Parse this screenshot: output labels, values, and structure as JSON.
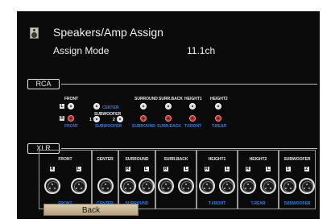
{
  "header": {
    "icon": "speaker-icon",
    "title": "Speakers/Amp Assign"
  },
  "assign_mode": {
    "label": "Assign Mode",
    "value": "11.1ch"
  },
  "rca": {
    "tag": "RCA",
    "front": {
      "label": "FRONT",
      "sub": "FRONT",
      "left_mark": "L",
      "right_mark": "R"
    },
    "center": {
      "label": "CENTER"
    },
    "subwoofer": {
      "label": "SUBWOOFER",
      "sub": "SUBWOOFER",
      "num1": "1",
      "num2": "2"
    },
    "surround": {
      "label": "SURROUND",
      "sub": "SURROUND"
    },
    "surr_back": {
      "label": "SURR.BACK",
      "sub": "SURR.BACK"
    },
    "height1": {
      "label": "HEIGHT1",
      "sub": "T.FRONT"
    },
    "height2": {
      "label": "HEIGHT2",
      "sub": "T.REAR"
    }
  },
  "xlr": {
    "tag": "XLR",
    "groups": [
      {
        "label": "FRONT",
        "sub": "FRONT",
        "marks": [
          "R",
          "L"
        ]
      },
      {
        "label": "CENTER",
        "sub": "CENTER",
        "marks": []
      },
      {
        "label": "SURROUND",
        "sub": "SURROUND",
        "marks": [
          "R",
          "L"
        ]
      },
      {
        "label": "SURR.BACK",
        "sub": "",
        "marks": [
          "R",
          "L"
        ]
      },
      {
        "label": "HEIGHT1",
        "sub": "T.FRONT",
        "marks": [
          "R",
          "L"
        ]
      },
      {
        "label": "HEIGHT2",
        "sub": "T.REAR",
        "marks": [
          "R",
          "L"
        ]
      },
      {
        "label": "SUBWOOFER",
        "sub": "SUBWOOFER",
        "marks": [
          "1",
          "2"
        ]
      }
    ]
  },
  "back_button": {
    "label": "Back"
  },
  "colors": {
    "background": "#0a0a0a",
    "accent": "#2f7fe0",
    "jack_red": "#c22a22",
    "button": "#c9b48e"
  }
}
